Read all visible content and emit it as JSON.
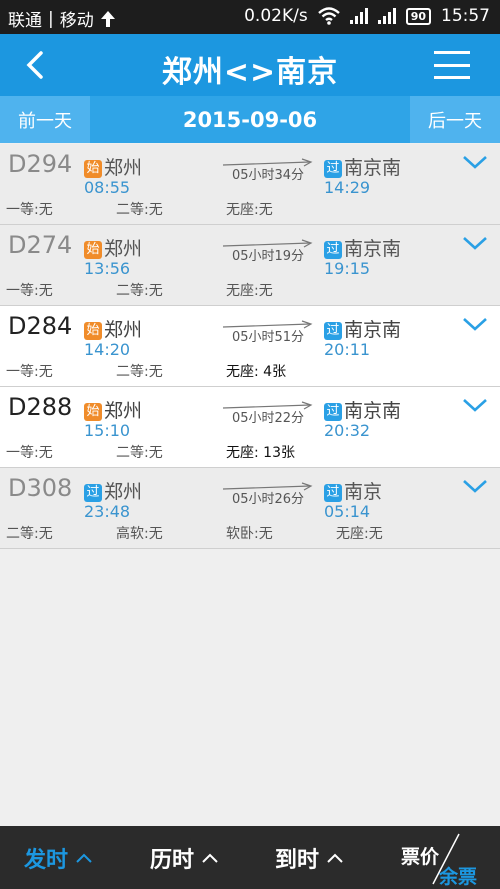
{
  "status": {
    "carrier1": "联通",
    "separator": "|",
    "carrier2": "移动",
    "speed": "0.02K/s",
    "battery": "90",
    "time": "15:57"
  },
  "header": {
    "title": "郑州<>南京",
    "back_icon": "chevron-left-icon",
    "menu_icon": "menu-icon"
  },
  "datebar": {
    "prev_label": "前一天",
    "date": "2015-09-06",
    "next_label": "后一天"
  },
  "trains": [
    {
      "no": "D294",
      "from_badge": "始",
      "from": "郑州",
      "dep": "08:55",
      "duration": "05小时34分",
      "to_badge": "过",
      "to": "南京南",
      "arr": "14:29",
      "seats": [
        {
          "text": "一等:无",
          "available": false
        },
        {
          "text": "二等:无",
          "available": false
        },
        {
          "text": "无座:无",
          "available": false
        }
      ],
      "highlight": false
    },
    {
      "no": "D274",
      "from_badge": "始",
      "from": "郑州",
      "dep": "13:56",
      "duration": "05小时19分",
      "to_badge": "过",
      "to": "南京南",
      "arr": "19:15",
      "seats": [
        {
          "text": "一等:无",
          "available": false
        },
        {
          "text": "二等:无",
          "available": false
        },
        {
          "text": "无座:无",
          "available": false
        }
      ],
      "highlight": false
    },
    {
      "no": "D284",
      "from_badge": "始",
      "from": "郑州",
      "dep": "14:20",
      "duration": "05小时51分",
      "to_badge": "过",
      "to": "南京南",
      "arr": "20:11",
      "seats": [
        {
          "text": "一等:无",
          "available": false
        },
        {
          "text": "二等:无",
          "available": false
        },
        {
          "text": "无座: 4张",
          "available": true
        }
      ],
      "highlight": true
    },
    {
      "no": "D288",
      "from_badge": "始",
      "from": "郑州",
      "dep": "15:10",
      "duration": "05小时22分",
      "to_badge": "过",
      "to": "南京南",
      "arr": "20:32",
      "seats": [
        {
          "text": "一等:无",
          "available": false
        },
        {
          "text": "二等:无",
          "available": false
        },
        {
          "text": "无座: 13张",
          "available": true
        }
      ],
      "highlight": true
    },
    {
      "no": "D308",
      "from_badge": "过",
      "from": "郑州",
      "dep": "23:48",
      "duration": "05小时26分",
      "to_badge": "过",
      "to": "南京",
      "arr": "05:14",
      "seats": [
        {
          "text": "二等:无",
          "available": false
        },
        {
          "text": "高软:无",
          "available": false
        },
        {
          "text": "软卧:无",
          "available": false
        },
        {
          "text": "无座:无",
          "available": false
        }
      ],
      "highlight": false
    }
  ],
  "bottom": {
    "tab_depart": "发时",
    "tab_duration": "历时",
    "tab_arrive": "到时",
    "price_label": "票价",
    "remain_label": "余票"
  },
  "colors": {
    "accent": "#1c97e0",
    "start_badge": "#f08c2a",
    "pass_badge": "#2aa0e5"
  }
}
